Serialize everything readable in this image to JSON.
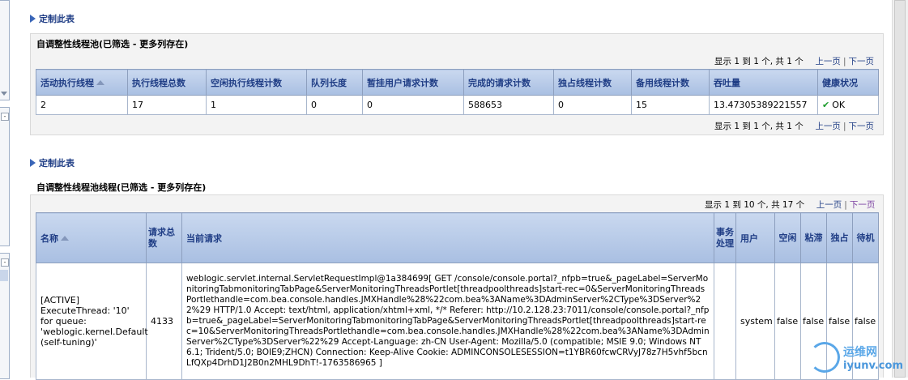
{
  "section1": {
    "customize_label": "定制此表",
    "title": "自调整性线程池(已筛选 - 更多列存在)",
    "pager": {
      "display": "显示 1 到 1 个, 共 1 个",
      "prev": "上一页",
      "next": "下一页"
    },
    "headers": [
      "活动执行线程",
      "执行线程总数",
      "空闲执行线程计数",
      "队列长度",
      "暂挂用户请求计数",
      "完成的请求计数",
      "独占线程计数",
      "备用线程计数",
      "吞吐量",
      "健康状况"
    ],
    "row": [
      "2",
      "17",
      "1",
      "0",
      "0",
      "588653",
      "0",
      "15",
      "13.47305389221557",
      "OK"
    ]
  },
  "section2": {
    "customize_label": "定制此表",
    "title": "自调整性线程池线程(已筛选 - 更多列存在)",
    "pager": {
      "display": "显示 1 到 10 个, 共 17 个",
      "prev": "上一页",
      "next": "下一页"
    },
    "headers": [
      "名称",
      "请求总数",
      "当前请求",
      "事务处理",
      "用户",
      "空闲",
      "粘滞",
      "独占",
      "待机"
    ],
    "row": {
      "name": "[ACTIVE] ExecuteThread: '10' for queue: 'weblogic.kernel.Default (self-tuning)'",
      "total_requests": "4133",
      "current_request": "weblogic.servlet.internal.ServletRequestImpl@1a384699[ GET /console/console.portal?_nfpb=true&_pageLabel=ServerMonitoringTabmonitoringTabPage&ServerMonitoringThreadsPortlet[threadpoolthreads]start-rec=0&ServerMonitoringThreadsPortlethandle=com.bea.console.handles.JMXHandle%28%22com.bea%3AName%3DAdminServer%2CType%3DServer%22%29 HTTP/1.0 Accept: text/html, application/xhtml+xml, */* Referer: http://10.2.128.23:7011/console/console.portal?_nfpb=true&_pageLabel=ServerMonitoringTabmonitoringTabPage&ServerMonitoringThreadsPortlet[threadpoolthreads]start-rec=10&ServerMonitoringThreadsPortlethandle=com.bea.console.handles.JMXHandle%28%22com.bea%3AName%3DAdminServer%2CType%3DServer%22%29 Accept-Language: zh-CN User-Agent: Mozilla/5.0 (compatible; MSIE 9.0; Windows NT 6.1; Trident/5.0; BOIE9;ZHCN) Connection: Keep-Alive Cookie: ADMINCONSOLESESSION=t1YBR60fcwCRVyJ78z7H5vhf5bcnLfQXp4DrhD1J2B0n2MHL9DhT!-1763586965 ]",
      "transaction": "",
      "user": "system",
      "idle": "false",
      "stuck": "false",
      "hogger": "false",
      "standby": "false"
    }
  },
  "watermark": {
    "top": "运维网",
    "bottom": "iyunv.com"
  },
  "colors": {
    "header_bg": "#b7c9e6",
    "link": "#1f3d85",
    "ok": "#1a9a2a"
  }
}
